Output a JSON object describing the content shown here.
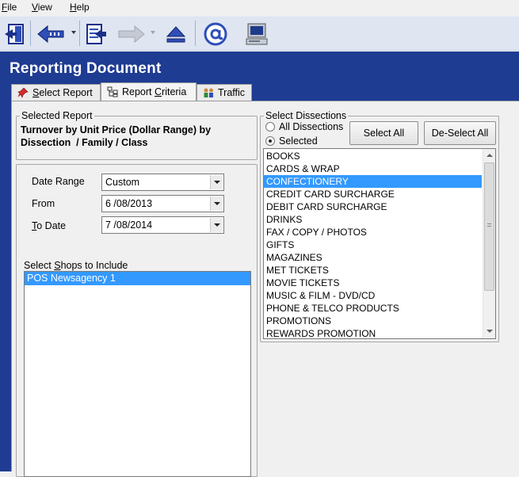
{
  "menu": {
    "file": {
      "u": "F",
      "rest": "ile"
    },
    "view": {
      "u": "V",
      "rest": "iew"
    },
    "help": {
      "u": "H",
      "rest": "elp"
    }
  },
  "toolbar": {
    "icons": [
      "exit-door-icon",
      "back-arrow-icon",
      "export-icon",
      "forward-arrow-icon",
      "eject-icon",
      "email-at-icon",
      "computer-icon"
    ]
  },
  "header": {
    "title": "Reporting Document"
  },
  "tabs": [
    {
      "pre": "",
      "u": "S",
      "post": "elect Report"
    },
    {
      "pre": "Report ",
      "u": "C",
      "post": "riteria"
    },
    {
      "pre": "",
      "u": "",
      "post": "Traffic"
    }
  ],
  "selected_report": {
    "legend": "Selected Report",
    "line1": "Turnover by Unit Price (Dollar Range) by",
    "line2": "Dissection  / Family / Class"
  },
  "criteria": {
    "date_range": {
      "label": "Date Range",
      "value": "Custom"
    },
    "from": {
      "label": "From",
      "value": "6 /08/2013"
    },
    "to_date": {
      "label_u": "T",
      "label_rest": "o Date",
      "value": "7 /08/2014"
    },
    "shops_label": {
      "pre": "Select ",
      "u": "S",
      "post": "hops to Include"
    },
    "shops": [
      "POS Newsagency 1"
    ]
  },
  "dissections": {
    "legend": "Select Dissections",
    "radio_all": "All Dissections",
    "radio_selected": "Selected",
    "select_all": "Select All",
    "deselect_all": "De-Select All",
    "items": [
      "BOOKS",
      "CARDS & WRAP",
      "CONFECTIONERY",
      "CREDIT CARD SURCHARGE",
      "DEBIT CARD SURCHARGE",
      "DRINKS",
      "FAX / COPY / PHOTOS",
      "GIFTS",
      "MAGAZINES",
      "MET TICKETS",
      "MOVIE TICKETS",
      "MUSIC & FILM - DVD/CD",
      "PHONE & TELCO PRODUCTS",
      "PROMOTIONS",
      "REWARDS PROMOTION"
    ],
    "selected_item": "CONFECTIONERY"
  },
  "colors": {
    "header_bg": "#1f3c93",
    "selection": "#3399ff",
    "toolbar_bg": "#dfe6f2"
  }
}
